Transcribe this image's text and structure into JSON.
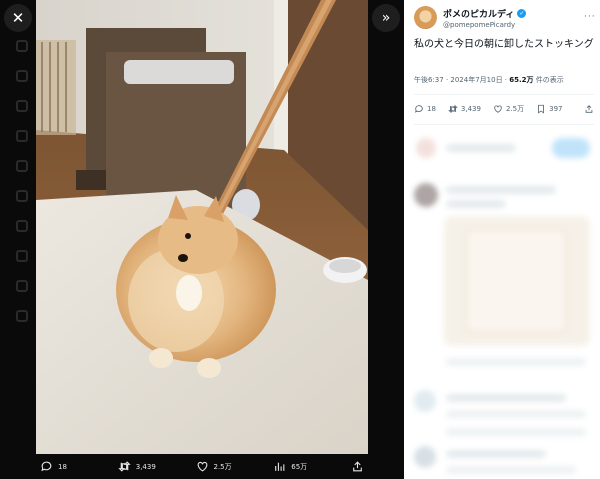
{
  "window": {
    "close_icon": "close-icon",
    "expand_icon": "expand-icon"
  },
  "media": {
    "description": "photo",
    "actions": {
      "replies": "18",
      "reposts": "3,439",
      "likes": "2.5万",
      "views": "65万"
    }
  },
  "tweet": {
    "display_name": "ポメのピカルディ",
    "handle": "@pomepomePicardy",
    "text": "私の犬と今日の朝に卸したストッキング",
    "time": "午後6:37 · 2024年7月10日 · ",
    "views_count": "65.2万",
    "views_label": " 件の表示",
    "stats": {
      "replies": "18",
      "reposts": "3,439",
      "likes": "2.5万",
      "bookmarks": "397"
    }
  },
  "colors": {
    "accent": "#1d9bf0",
    "text": "#0f1419",
    "muted": "#536471"
  }
}
